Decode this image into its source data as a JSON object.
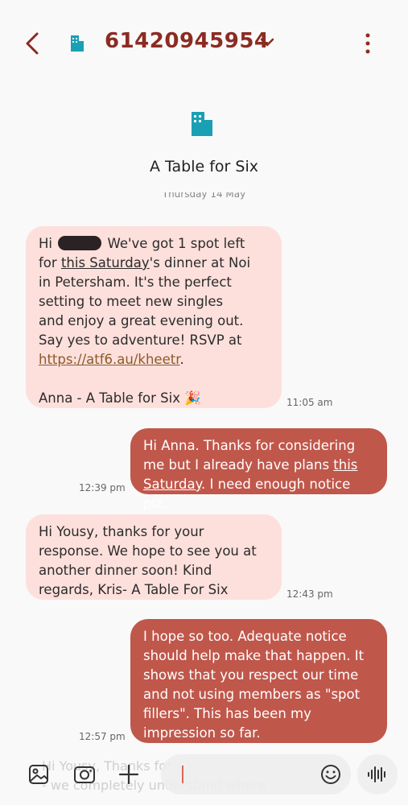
{
  "header": {
    "contact_number": "61420945954"
  },
  "contact": {
    "name": "A Table for Six"
  },
  "date_separator": "Thursday 14 May",
  "messages": [
    {
      "direction": "incoming",
      "greeting": "Hi",
      "line_a": "We've got 1 spot left",
      "line_b_pre": "for ",
      "line_b_link": "this Saturday",
      "line_b_post": "'s dinner at Noi",
      "line_c": "in Petersham. It's the perfect",
      "line_d": "setting to meet new singles",
      "line_e": "and enjoy a great evening out.",
      "line_f": "Say yes to adventure! RSVP at",
      "url": "https://atf6.au/kheetr",
      "url_suffix": ".",
      "signature": "Anna - A Table for Six 🎉",
      "time": "11:05 am"
    },
    {
      "direction": "outgoing",
      "text_a": "Hi Anna. Thanks for considering",
      "text_b": "me but I already have plans ",
      "link_a": "this",
      "link_b": "Saturday",
      "text_c": ". I need enough notice plz.",
      "time": "12:39 pm"
    },
    {
      "direction": "incoming",
      "text": "Hi Yousy, thanks for your response. We hope to see you at another dinner soon! Kind regards, Kris- A Table For Six",
      "time": "12:43 pm"
    },
    {
      "direction": "outgoing",
      "text": "I hope so too. Adequate notice should help make that happen. It shows that you respect our time and not using members as \"spot fillers\". This has been my impression so far.",
      "time": "12:57 pm"
    }
  ],
  "preview_behind": {
    "line1": "Hi Yousy, Thanks for",
    "line2": "- we completely understand where"
  },
  "colors": {
    "accent": "#8c2b22",
    "incoming_bubble": "#fde0dc",
    "outgoing_bubble": "#c0574b",
    "business_icon": "#1aa0b4"
  },
  "icons": {
    "back": "back-arrow-icon",
    "business": "building-icon",
    "dropdown": "chevron-down-icon",
    "more": "more-vert-icon",
    "gallery": "gallery-icon",
    "camera": "camera-icon",
    "add": "plus-icon",
    "emoji": "emoji-icon",
    "voice": "voice-wave-icon"
  }
}
